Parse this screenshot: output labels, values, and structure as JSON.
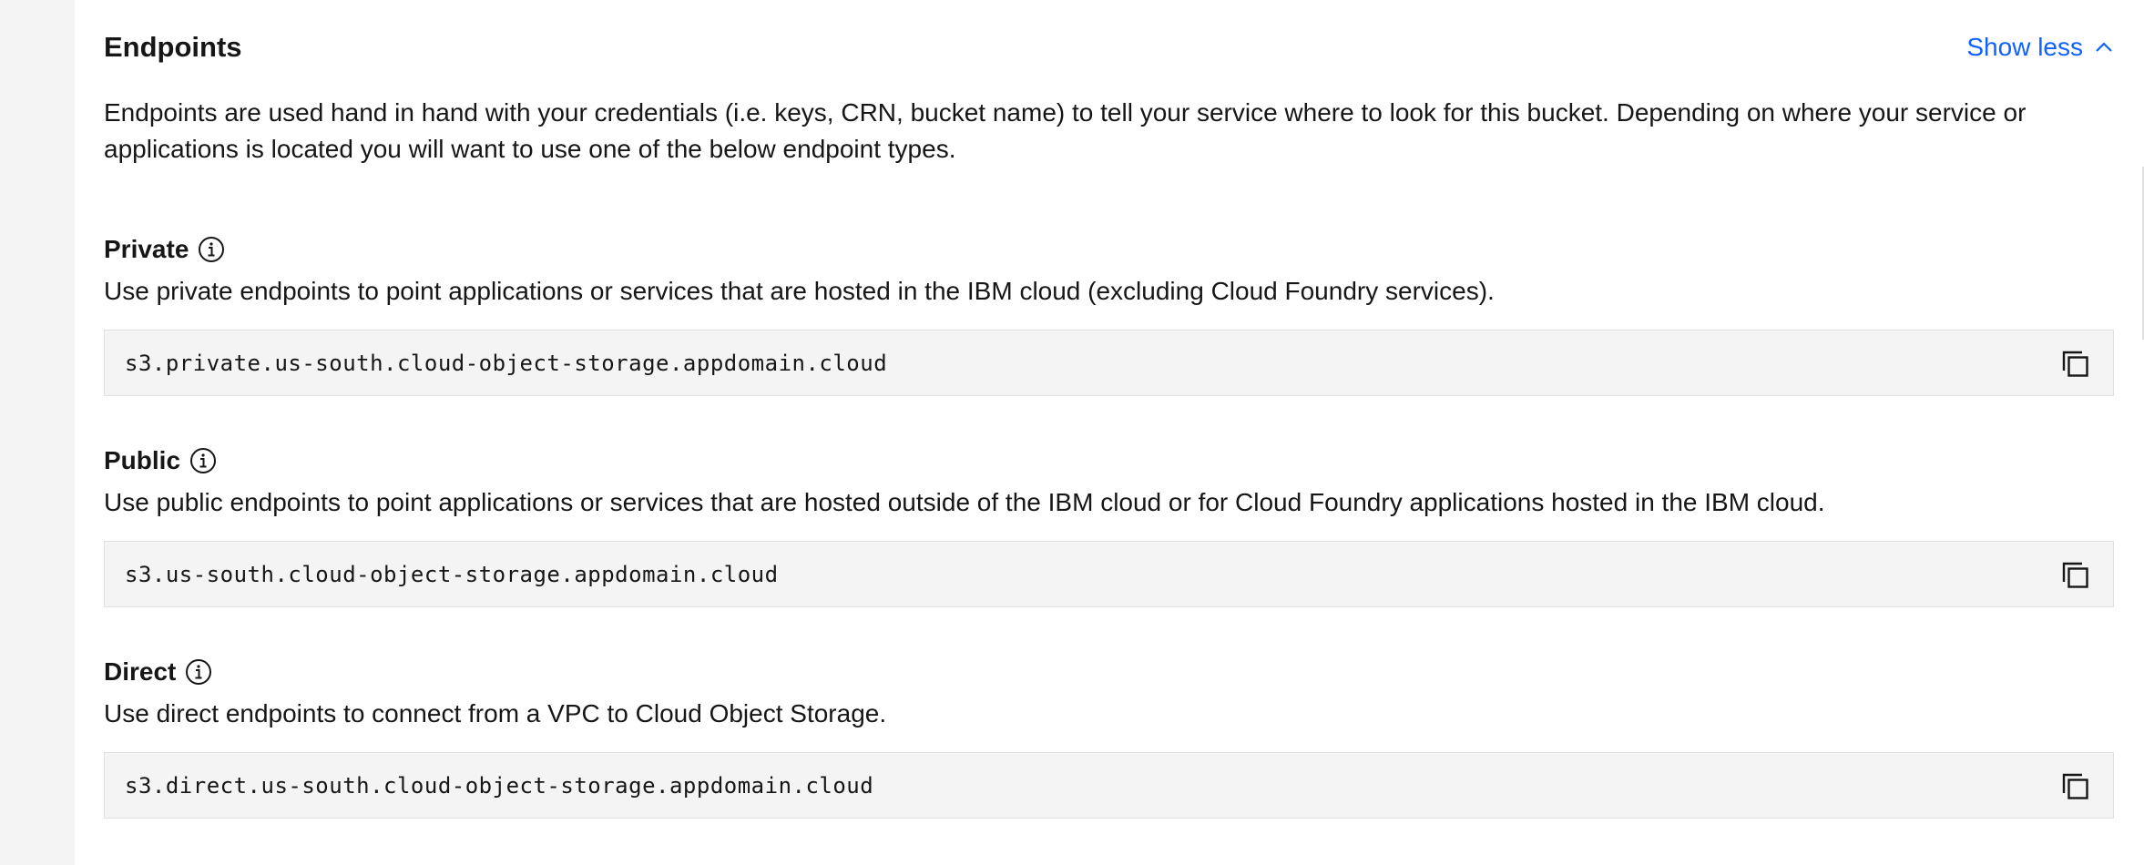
{
  "section": {
    "title": "Endpoints",
    "toggle_label": "Show less",
    "intro": "Endpoints are used hand in hand with your credentials (i.e. keys, CRN, bucket name) to tell your service where to look for this bucket. Depending on where your service or applications is located you will want to use one of the below endpoint types."
  },
  "endpoints": [
    {
      "title": "Private",
      "description": "Use private endpoints to point applications or services that are hosted in the IBM cloud (excluding Cloud Foundry services).",
      "url": "s3.private.us-south.cloud-object-storage.appdomain.cloud"
    },
    {
      "title": "Public",
      "description": "Use public endpoints to point applications or services that are hosted outside of the IBM cloud or for Cloud Foundry applications hosted in the IBM cloud.",
      "url": "s3.us-south.cloud-object-storage.appdomain.cloud"
    },
    {
      "title": "Direct",
      "description": "Use direct endpoints to connect from a VPC to Cloud Object Storage.",
      "url": "s3.direct.us-south.cloud-object-storage.appdomain.cloud"
    }
  ],
  "icons": {
    "info": "info-icon",
    "copy": "copy-icon",
    "toggle": "chevron-up-icon"
  },
  "colors": {
    "link": "#0f62fe",
    "code_background": "#f4f4f4",
    "text": "#161616"
  }
}
